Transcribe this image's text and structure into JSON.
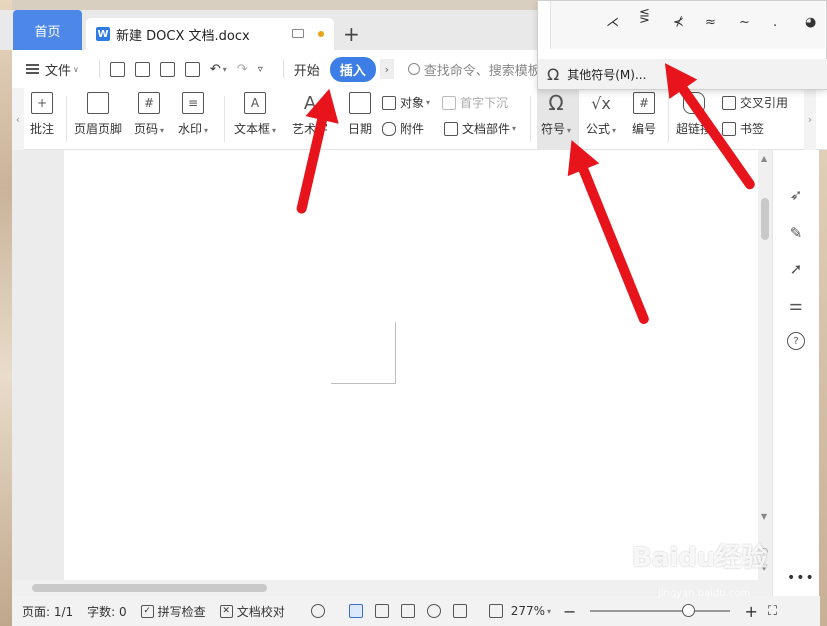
{
  "title_bar": {
    "home_tab": "首页",
    "doc_tab": {
      "icon": "W",
      "title": "新建 DOCX 文档.docx"
    },
    "add_tab": "+"
  },
  "menu_bar": {
    "file_label": "文件",
    "start_label": "开始",
    "insert_label": "插入",
    "search_placeholder": "查找命令、搜索模板"
  },
  "ribbon": {
    "comment": "批注",
    "header_footer": "页眉页脚",
    "page_number": "页码",
    "watermark": "水印",
    "textbox": "文本框",
    "wordart": "艺术字",
    "date": "日期",
    "object": "对象",
    "drop_cap": "首字下沉",
    "attachment": "附件",
    "doc_parts": "文档部件",
    "symbol": "符号",
    "formula": "公式",
    "numbering": "编号",
    "hyperlink": "超链接",
    "cross_ref": "交叉引用",
    "bookmark": "书签"
  },
  "symbol_dropdown": {
    "symbols": [
      "⋌",
      "⋚",
      "⊀",
      "≈",
      "~",
      ".",
      "◕"
    ],
    "more_symbols": "其他符号(M)..."
  },
  "status_bar": {
    "page": "页面: 1/1",
    "word_count": "字数: 0",
    "spell_check": "拼写检查",
    "proofread": "文档校对",
    "zoom": "277%",
    "zoom_level_percent": 277
  },
  "watermark_text": {
    "brand": "Baidu经验",
    "url": "jingyan.baidu.com"
  }
}
